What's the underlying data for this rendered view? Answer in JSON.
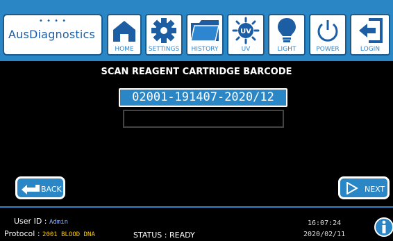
{
  "header": {
    "logo": "AusDiagnostics",
    "nav": [
      {
        "id": "home",
        "label": "HOME",
        "icon": "home-icon"
      },
      {
        "id": "settings",
        "label": "SETTINGS",
        "icon": "gear-icon"
      },
      {
        "id": "history",
        "label": "HISTORY",
        "icon": "folder-icon"
      },
      {
        "id": "uv",
        "label": "UV",
        "icon": "uv-lamp-icon"
      },
      {
        "id": "light",
        "label": "LIGHT",
        "icon": "lightbulb-icon"
      },
      {
        "id": "power",
        "label": "POWER",
        "icon": "power-icon"
      },
      {
        "id": "login",
        "label": "LOGIN",
        "icon": "login-icon"
      }
    ]
  },
  "main": {
    "title": "SCAN REAGENT CARTRIDGE BARCODE",
    "barcode_value": "02001-191407-2020/12",
    "secondary_value": ""
  },
  "actions": {
    "back_label": "BACK",
    "next_label": "NEXT"
  },
  "footer": {
    "user_label": "User ID :",
    "user_value": "Admin",
    "protocol_label": "Protocol :",
    "protocol_value": "2001 BLOOD DNA",
    "status_label": "STATUS : READY",
    "time": "16:07:24",
    "date": "2020/02/11"
  },
  "colors": {
    "accent": "#2b86c6",
    "protocol": "#ffcc00"
  }
}
